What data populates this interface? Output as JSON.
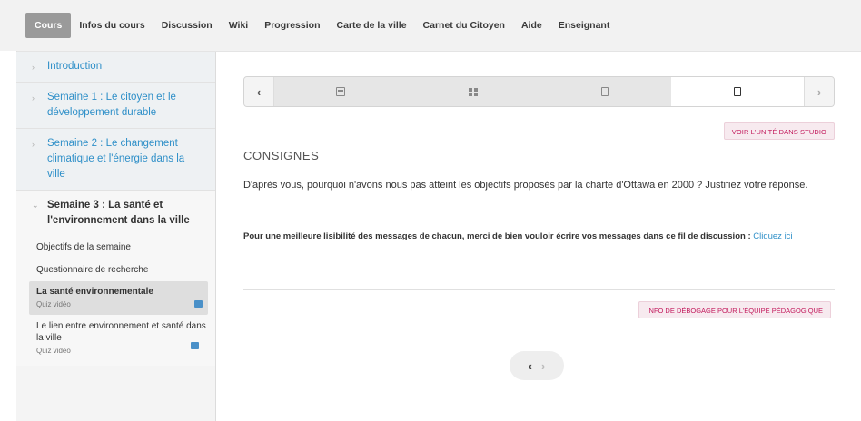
{
  "nav": {
    "tabs": [
      "Cours",
      "Infos du cours",
      "Discussion",
      "Wiki",
      "Progression",
      "Carte de la ville",
      "Carnet du Citoyen",
      "Aide",
      "Enseignant"
    ]
  },
  "sidebar": {
    "chapters": [
      {
        "label": "Introduction"
      },
      {
        "label": "Semaine 1 : Le citoyen et le développement durable"
      },
      {
        "label": "Semaine 2 : Le changement climatique et l'énergie dans la ville"
      },
      {
        "label": "Semaine 3 : La santé et l'environnement dans la ville"
      }
    ],
    "subsections": [
      {
        "label": "Objectifs de la semaine"
      },
      {
        "label": "Questionnaire de recherche"
      },
      {
        "label": "La santé environnementale",
        "meta": "Quiz vidéo"
      },
      {
        "label": "Le lien entre environnement et santé dans la ville",
        "meta": "Quiz vidéo"
      }
    ]
  },
  "content": {
    "studio_button": "VOIR L'UNITÉ DANS STUDIO",
    "section_title": "CONSIGNES",
    "prompt": "D'après vous, pourquoi n'avons nous pas atteint les objectifs proposés par la charte d'Ottawa en 2000 ? Justifiez votre réponse.",
    "note_text": "Pour une meilleure lisibilité des messages de chacun, merci de bien vouloir écrire vos messages dans ce fil de discussion :",
    "note_link": "Cliquez ici",
    "debug_button": "INFO DE DÉBOGAGE POUR L'ÉQUIPE PÉDAGOGIQUE"
  },
  "sequence": {
    "prev": "‹",
    "next": "›",
    "icons": [
      "video-icon",
      "problem-grid-icon",
      "document-icon",
      "document-icon"
    ]
  },
  "bottom_nav": {
    "prev": "‹",
    "next": "›"
  }
}
